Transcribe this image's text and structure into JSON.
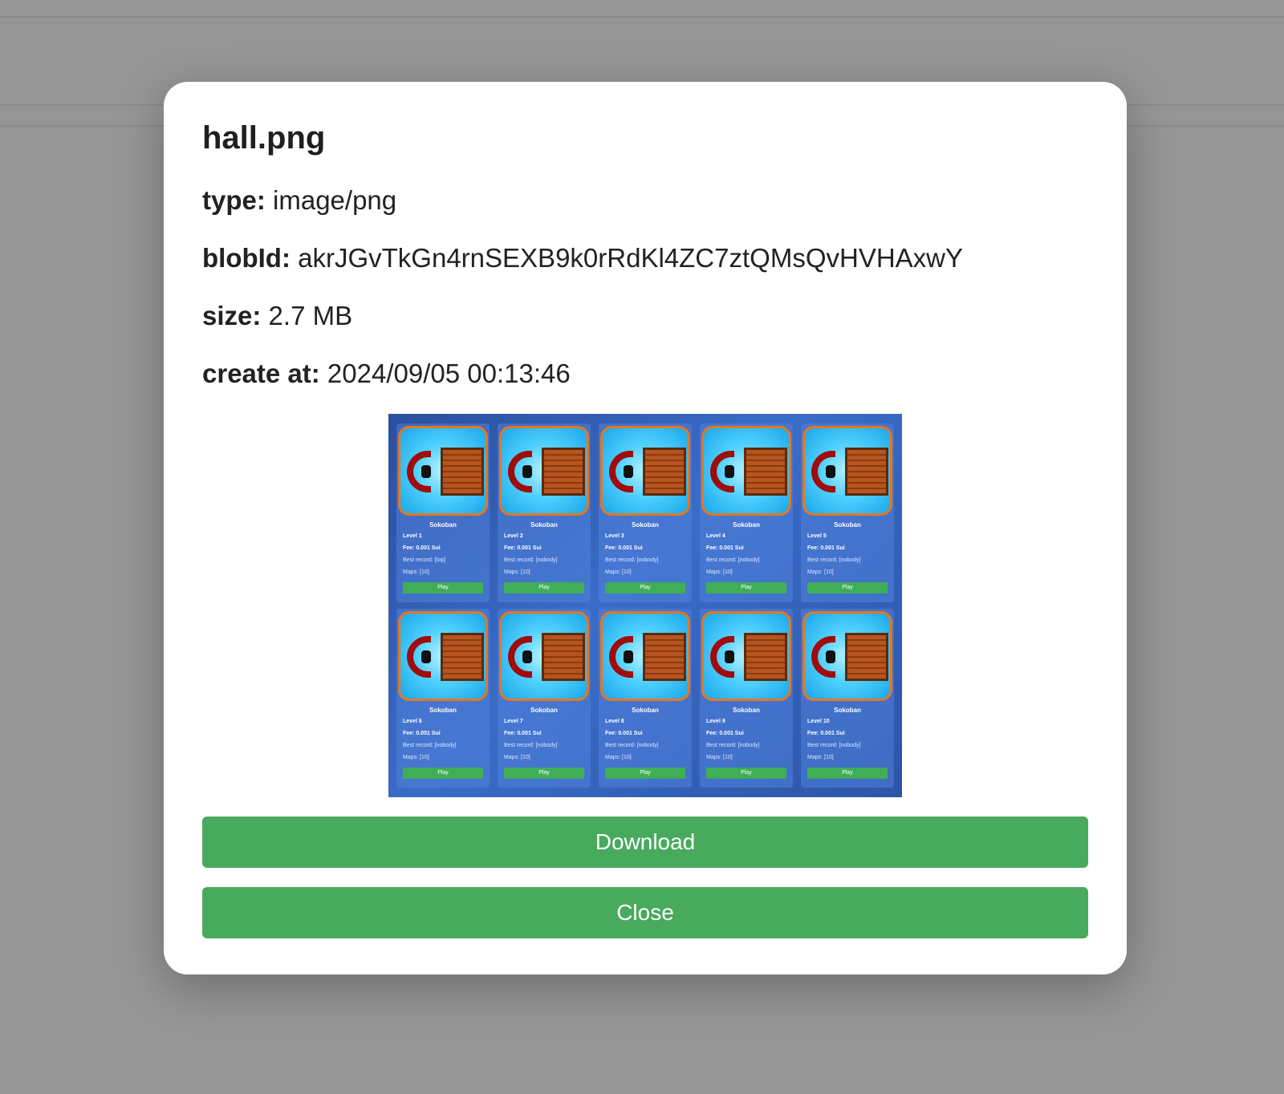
{
  "modal": {
    "title": "hall.png",
    "fields": [
      {
        "label": "type:",
        "value": "image/png"
      },
      {
        "label": "blobId:",
        "value": "akrJGvTkGn4rnSEXB9k0rRdKl4ZC7ztQMsQvHVHAxwY"
      },
      {
        "label": "size:",
        "value": "2.7 MB"
      },
      {
        "label": "create at:",
        "value": "2024/09/05 00:13:46"
      }
    ],
    "download_label": "Download",
    "close_label": "Close"
  },
  "preview": {
    "cards": [
      {
        "title": "Sokoban",
        "level": "Level 1",
        "fee": "Fee: 0.001 Sui",
        "record": "Best record: [top]",
        "maps": "Maps: [10]",
        "play": "Play"
      },
      {
        "title": "Sokoban",
        "level": "Level 2",
        "fee": "Fee: 0.001 Sui",
        "record": "Best record: [nobody]",
        "maps": "Maps: [10]",
        "play": "Play"
      },
      {
        "title": "Sokoban",
        "level": "Level 3",
        "fee": "Fee: 0.001 Sui",
        "record": "Best record: [nobody]",
        "maps": "Maps: [10]",
        "play": "Play"
      },
      {
        "title": "Sokoban",
        "level": "Level 4",
        "fee": "Fee: 0.001 Sui",
        "record": "Best record: [nobody]",
        "maps": "Maps: [10]",
        "play": "Play"
      },
      {
        "title": "Sokoban",
        "level": "Level 5",
        "fee": "Fee: 0.001 Sui",
        "record": "Best record: [nobody]",
        "maps": "Maps: [10]",
        "play": "Play"
      },
      {
        "title": "Sokoban",
        "level": "Level 6",
        "fee": "Fee: 0.001 Sui",
        "record": "Best record: [nobody]",
        "maps": "Maps: [10]",
        "play": "Play"
      },
      {
        "title": "Sokoban",
        "level": "Level 7",
        "fee": "Fee: 0.001 Sui",
        "record": "Best record: [nobody]",
        "maps": "Maps: [10]",
        "play": "Play"
      },
      {
        "title": "Sokoban",
        "level": "Level 8",
        "fee": "Fee: 0.001 Sui",
        "record": "Best record: [nobody]",
        "maps": "Maps: [10]",
        "play": "Play"
      },
      {
        "title": "Sokoban",
        "level": "Level 9",
        "fee": "Fee: 0.001 Sui",
        "record": "Best record: [nobody]",
        "maps": "Maps: [10]",
        "play": "Play"
      },
      {
        "title": "Sokoban",
        "level": "Level 10",
        "fee": "Fee: 0.001 Sui",
        "record": "Best record: [nobody]",
        "maps": "Maps: [10]",
        "play": "Play"
      }
    ]
  },
  "colors": {
    "overlay": "#969696",
    "button": "#48aa5c",
    "button_text": "#ffffff"
  }
}
